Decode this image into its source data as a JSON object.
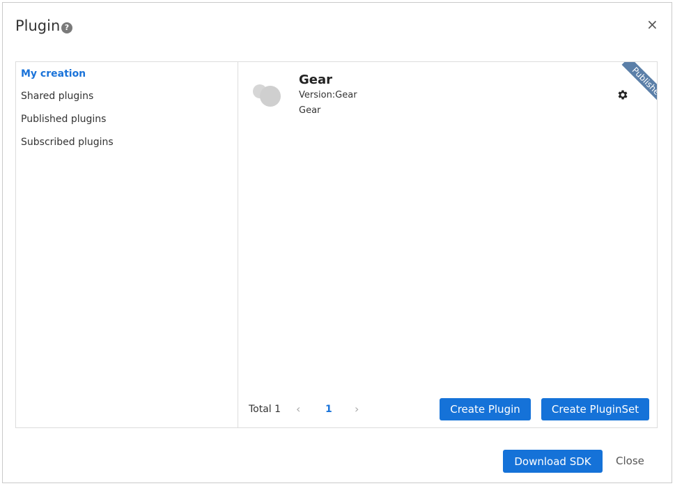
{
  "dialog": {
    "title": "Plugin",
    "help_icon": "question-circle-icon",
    "close_symbol": "×"
  },
  "sidebar": {
    "items": [
      {
        "label": "My creation",
        "active": true
      },
      {
        "label": "Shared plugins",
        "active": false
      },
      {
        "label": "Published plugins",
        "active": false
      },
      {
        "label": "Subscribed plugins",
        "active": false
      }
    ]
  },
  "plugin_card": {
    "name": "Gear",
    "version": "Version:Gear",
    "description": "Gear",
    "ribbon": "Published",
    "settings_icon": "gear-icon"
  },
  "pagination": {
    "total": "Total 1",
    "prev": "‹",
    "current_page": "1",
    "next": "›"
  },
  "actions": {
    "create_plugin": "Create Plugin",
    "create_pluginset": "Create PluginSet",
    "download_sdk": "Download SDK",
    "close": "Close"
  },
  "colors": {
    "accent": "#1572d8",
    "active_link": "#1a73d9",
    "ribbon": "#5b7fa8"
  }
}
